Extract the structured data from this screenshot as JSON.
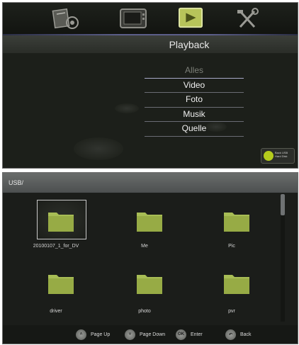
{
  "playback_screen": {
    "icons": [
      "settings-app-icon",
      "tv-icon",
      "playback-icon",
      "tools-icon"
    ],
    "title": "Playback",
    "menu": [
      {
        "label": "Alles",
        "state": "dim"
      },
      {
        "label": "Video",
        "state": "normal"
      },
      {
        "label": "Foto",
        "state": "normal"
      },
      {
        "label": "Musik",
        "state": "normal"
      },
      {
        "label": "Quelle",
        "state": "normal"
      }
    ],
    "back_badge": {
      "line1": "Back USB",
      "line2": "Hard Disk"
    },
    "colors": {
      "accent": "#b5cc1c",
      "folder": "#9db24e"
    }
  },
  "browser_screen": {
    "path": "USB/",
    "folders": [
      {
        "name": "20100107_1_for_DV",
        "selected": true
      },
      {
        "name": "Me",
        "selected": false
      },
      {
        "name": "Pic",
        "selected": false
      },
      {
        "name": "driver",
        "selected": false
      },
      {
        "name": "photo",
        "selected": false
      },
      {
        "name": "pvr",
        "selected": false
      }
    ],
    "footer": [
      {
        "icon": "page-up-icon",
        "label": "Page Up",
        "glyph": "˄"
      },
      {
        "icon": "page-down-icon",
        "label": "Page Down",
        "glyph": "˅"
      },
      {
        "icon": "ok-icon",
        "label": "Enter",
        "glyph": "OK"
      },
      {
        "icon": "back-icon",
        "label": "Back",
        "glyph": "↶"
      }
    ]
  }
}
